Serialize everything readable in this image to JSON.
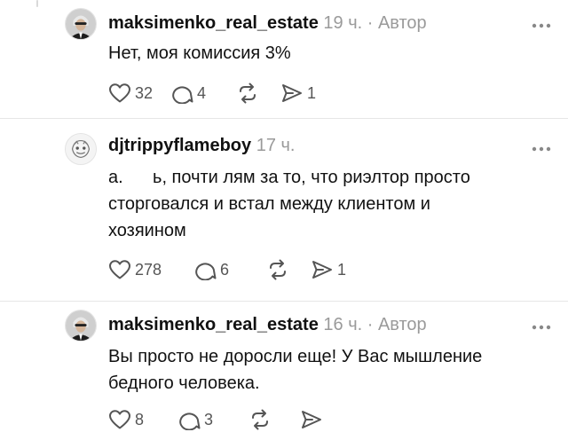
{
  "icons": {
    "like": "heart-icon",
    "reply": "comment-bubble-icon",
    "repost": "repost-icon",
    "share": "send-icon",
    "more": "more-dots-icon",
    "avatar_broker": "avatar-photo",
    "avatar_commenter": "avatar-illustration"
  },
  "colors": {
    "text": "#111111",
    "meta": "#9a9a9a",
    "icon": "#555555",
    "divider": "#e6e6e6"
  },
  "posts": [
    {
      "username": "maksimenko_real_estate",
      "time": "19 ч.",
      "separator": "·",
      "badge": "Автор",
      "text_lines": [
        "Нет, моя комиссия 3%"
      ],
      "likes": "32",
      "replies": "4",
      "shares": "1"
    },
    {
      "username": "djtrippyflameboy",
      "time": "17 ч.",
      "text_lines": [
        "а.      ь, почти лям за то, что риэлтор просто",
        "сторговался и встал между клиентом и",
        "хозяином"
      ],
      "likes": "278",
      "replies": "6",
      "shares": "1"
    },
    {
      "username": "maksimenko_real_estate",
      "time": "16 ч.",
      "separator": "·",
      "badge": "Автор",
      "text_lines": [
        "Вы просто не доросли еще! У Вас мышление",
        "бедного человека."
      ],
      "likes": "8",
      "replies": "3"
    }
  ]
}
